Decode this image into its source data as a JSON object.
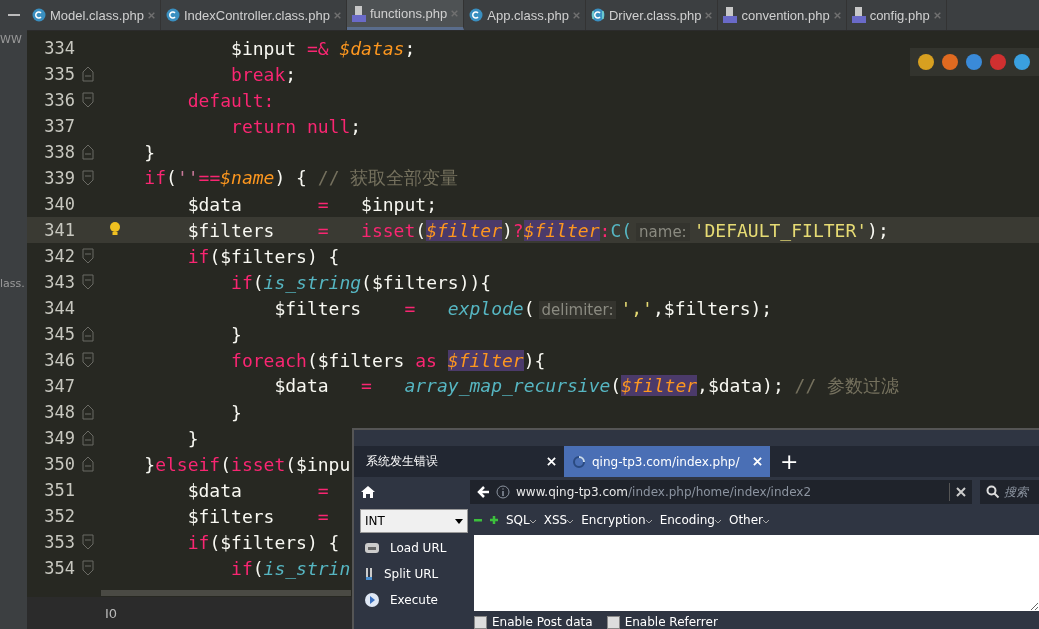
{
  "file_tabs": [
    {
      "label": "Model.class.php",
      "kind": "class",
      "selected": false
    },
    {
      "label": "IndexController.class.php",
      "kind": "class",
      "selected": false
    },
    {
      "label": "functions.php",
      "kind": "php",
      "selected": true
    },
    {
      "label": "App.class.php",
      "kind": "class",
      "selected": false
    },
    {
      "label": "Driver.class.php",
      "kind": "interface",
      "selected": false
    },
    {
      "label": "convention.php",
      "kind": "php",
      "selected": false
    },
    {
      "label": "config.php",
      "kind": "php",
      "selected": false
    }
  ],
  "project_panel": {
    "items": [
      {
        "label": "WW"
      },
      {
        "label": "lass."
      }
    ]
  },
  "browser_icons": [
    {
      "color": "#d8a020"
    },
    {
      "color": "#e06a20"
    },
    {
      "color": "#3a8ad8"
    },
    {
      "color": "#d03030"
    },
    {
      "color": "#3aa0e0"
    }
  ],
  "code_lines": [
    {
      "number": "334",
      "fold_open": false,
      "fold_close": false,
      "current": false,
      "bulb": false,
      "tokens": [
        {
          "text": "            $input ",
          "kind": "plain"
        },
        {
          "text": "=&",
          "kind": "op"
        },
        {
          "text": " $datas",
          "kind": "var"
        },
        {
          "text": ";",
          "kind": "plain"
        }
      ]
    },
    {
      "number": "335",
      "fold_open": false,
      "fold_close": true,
      "current": false,
      "bulb": false,
      "tokens": [
        {
          "text": "            break",
          "kind": "kw"
        },
        {
          "text": ";",
          "kind": "plain"
        }
      ]
    },
    {
      "number": "336",
      "fold_open": true,
      "fold_close": false,
      "current": false,
      "bulb": false,
      "tokens": [
        {
          "text": "        default:",
          "kind": "kw"
        }
      ]
    },
    {
      "number": "337",
      "fold_open": false,
      "fold_close": false,
      "current": false,
      "bulb": false,
      "tokens": [
        {
          "text": "            return null",
          "kind": "kw"
        },
        {
          "text": ";",
          "kind": "plain"
        }
      ]
    },
    {
      "number": "338",
      "fold_open": false,
      "fold_close": true,
      "current": false,
      "bulb": false,
      "tokens": [
        {
          "text": "    }",
          "kind": "plain"
        }
      ]
    },
    {
      "number": "339",
      "fold_open": true,
      "fold_close": false,
      "current": false,
      "bulb": false,
      "tokens": [
        {
          "text": "    if",
          "kind": "kw"
        },
        {
          "text": "(",
          "kind": "plain"
        },
        {
          "text": "''",
          "kind": "str2"
        },
        {
          "text": "==",
          "kind": "op"
        },
        {
          "text": "$name",
          "kind": "var"
        },
        {
          "text": ") { ",
          "kind": "plain"
        },
        {
          "text": "// 获取全部变量",
          "kind": "comment"
        }
      ]
    },
    {
      "number": "340",
      "fold_open": false,
      "fold_close": false,
      "current": false,
      "bulb": false,
      "tokens": [
        {
          "text": "        $data       ",
          "kind": "plain"
        },
        {
          "text": "=",
          "kind": "op"
        },
        {
          "text": "   $input;",
          "kind": "plain"
        }
      ]
    },
    {
      "number": "341",
      "fold_open": false,
      "fold_close": false,
      "current": true,
      "bulb": true,
      "tokens": [
        {
          "text": "        $filters    ",
          "kind": "plain"
        },
        {
          "text": "=",
          "kind": "op"
        },
        {
          "text": "   isset",
          "kind": "kw"
        },
        {
          "text": "(",
          "kind": "plain"
        },
        {
          "text": "$filter",
          "kind": "varhl"
        },
        {
          "text": ")",
          "kind": "plain"
        },
        {
          "text": "?",
          "kind": "op"
        },
        {
          "text": "$filter",
          "kind": "varhl"
        },
        {
          "text": ":",
          "kind": "op"
        },
        {
          "text": "C(",
          "kind": "call"
        },
        {
          "text": "name:",
          "kind": "hint"
        },
        {
          "text": "'DEFAULT_FILTER'",
          "kind": "str"
        },
        {
          "text": ");",
          "kind": "plain"
        }
      ]
    },
    {
      "number": "342",
      "fold_open": true,
      "fold_close": false,
      "current": false,
      "bulb": false,
      "tokens": [
        {
          "text": "        if",
          "kind": "kw"
        },
        {
          "text": "($filters) {",
          "kind": "plain"
        }
      ]
    },
    {
      "number": "343",
      "fold_open": true,
      "fold_close": false,
      "current": false,
      "bulb": false,
      "tokens": [
        {
          "text": "            if",
          "kind": "kw"
        },
        {
          "text": "(",
          "kind": "plain"
        },
        {
          "text": "is_string",
          "kind": "func"
        },
        {
          "text": "($filters)){",
          "kind": "plain"
        }
      ]
    },
    {
      "number": "344",
      "fold_open": false,
      "fold_close": false,
      "current": false,
      "bulb": false,
      "tokens": [
        {
          "text": "                $filters    ",
          "kind": "plain"
        },
        {
          "text": "=",
          "kind": "op"
        },
        {
          "text": "   explode",
          "kind": "func"
        },
        {
          "text": "(",
          "kind": "plain"
        },
        {
          "text": "delimiter:",
          "kind": "hint"
        },
        {
          "text": "','",
          "kind": "str"
        },
        {
          "text": ",$filters);",
          "kind": "plain"
        }
      ]
    },
    {
      "number": "345",
      "fold_open": false,
      "fold_close": true,
      "current": false,
      "bulb": false,
      "tokens": [
        {
          "text": "            }",
          "kind": "plain"
        }
      ]
    },
    {
      "number": "346",
      "fold_open": true,
      "fold_close": false,
      "current": false,
      "bulb": false,
      "tokens": [
        {
          "text": "            foreach",
          "kind": "kw"
        },
        {
          "text": "($filters ",
          "kind": "plain"
        },
        {
          "text": "as ",
          "kind": "kw"
        },
        {
          "text": "$filter",
          "kind": "varhl"
        },
        {
          "text": "){",
          "kind": "plain"
        }
      ]
    },
    {
      "number": "347",
      "fold_open": false,
      "fold_close": false,
      "current": false,
      "bulb": false,
      "tokens": [
        {
          "text": "                $data   ",
          "kind": "plain"
        },
        {
          "text": "=",
          "kind": "op"
        },
        {
          "text": "   array_map_recursive",
          "kind": "func"
        },
        {
          "text": "(",
          "kind": "plain"
        },
        {
          "text": "$filter",
          "kind": "varhl"
        },
        {
          "text": ",$data); ",
          "kind": "plain"
        },
        {
          "text": "// 参数过滤",
          "kind": "comment"
        }
      ]
    },
    {
      "number": "348",
      "fold_open": false,
      "fold_close": true,
      "current": false,
      "bulb": false,
      "tokens": [
        {
          "text": "            }",
          "kind": "plain"
        }
      ]
    },
    {
      "number": "349",
      "fold_open": false,
      "fold_close": true,
      "current": false,
      "bulb": false,
      "tokens": [
        {
          "text": "        }",
          "kind": "plain"
        }
      ]
    },
    {
      "number": "350",
      "fold_open": false,
      "fold_close": true,
      "current": false,
      "bulb": false,
      "tokens": [
        {
          "text": "    }",
          "kind": "plain"
        },
        {
          "text": "elseif",
          "kind": "kw"
        },
        {
          "text": "(",
          "kind": "plain"
        },
        {
          "text": "isset",
          "kind": "kw"
        },
        {
          "text": "($inpu",
          "kind": "plain"
        }
      ]
    },
    {
      "number": "351",
      "fold_open": false,
      "fold_close": false,
      "current": false,
      "bulb": false,
      "tokens": [
        {
          "text": "        $data       ",
          "kind": "plain"
        },
        {
          "text": "=",
          "kind": "op"
        }
      ]
    },
    {
      "number": "352",
      "fold_open": false,
      "fold_close": false,
      "current": false,
      "bulb": false,
      "tokens": [
        {
          "text": "        $filters    ",
          "kind": "plain"
        },
        {
          "text": "=",
          "kind": "op"
        }
      ]
    },
    {
      "number": "353",
      "fold_open": true,
      "fold_close": false,
      "current": false,
      "bulb": false,
      "tokens": [
        {
          "text": "        if",
          "kind": "kw"
        },
        {
          "text": "($filters) {",
          "kind": "plain"
        }
      ]
    },
    {
      "number": "354",
      "fold_open": true,
      "fold_close": false,
      "current": false,
      "bulb": false,
      "tokens": [
        {
          "text": "            if",
          "kind": "kw"
        },
        {
          "text": "(",
          "kind": "plain"
        },
        {
          "text": "is_strin",
          "kind": "func"
        }
      ]
    }
  ],
  "status_bar": {
    "text": "I0"
  },
  "browser": {
    "tabs": [
      {
        "label": "系统发生错误",
        "selected": false,
        "loading": false
      },
      {
        "label": "qing-tp3.com/index.php/",
        "selected": true,
        "loading": true
      }
    ],
    "new_tab": "+",
    "url": "**www.qing-tp3.com**/index.php/home/index/index2",
    "search_placeholder": "搜索",
    "hackbar": {
      "select_value": "INT",
      "menus": [
        "SQL",
        "XSS",
        "Encryption",
        "Encoding",
        "Other"
      ],
      "actions": [
        {
          "label": "Load URL",
          "kind": "load"
        },
        {
          "label": "Split URL",
          "kind": "split"
        },
        {
          "label": "Execute",
          "kind": "execute"
        }
      ],
      "checkboxes": [
        {
          "label": "Enable Post data",
          "checked": false
        },
        {
          "label": "Enable Referrer",
          "checked": false
        }
      ]
    }
  }
}
